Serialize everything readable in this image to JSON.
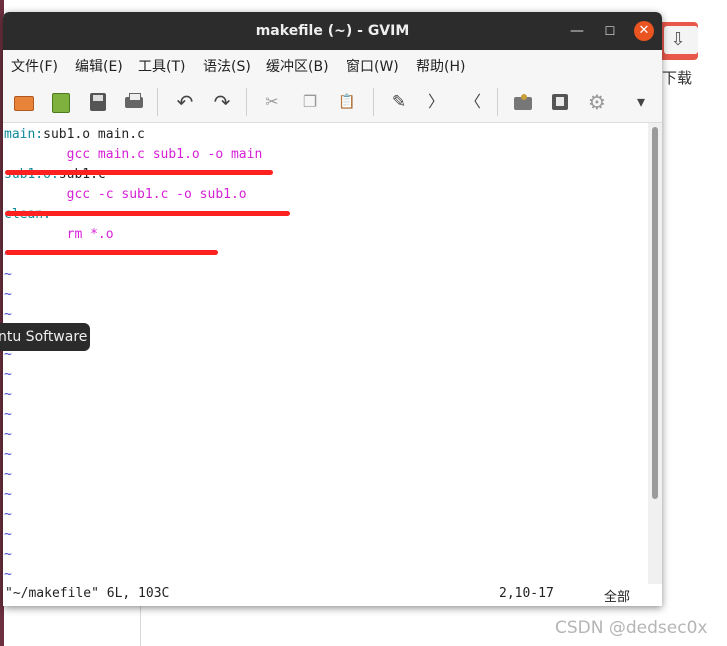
{
  "window": {
    "title": "makefile (~) - GVIM",
    "minimize_icon": "minimize-icon",
    "maximize_icon": "maximize-icon",
    "close_icon": "close-icon",
    "minimize_glyph": "—",
    "maximize_glyph": "☐",
    "close_glyph": "✕"
  },
  "menubar": {
    "items": [
      "文件(F)",
      "编辑(E)",
      "工具(T)",
      "语法(S)",
      "缓冲区(B)",
      "窗口(W)",
      "帮助(H)"
    ]
  },
  "toolbar": {
    "icons": [
      "open-file-icon",
      "save-icon",
      "save-all-icon",
      "print-icon",
      "undo-icon",
      "redo-icon",
      "cut-icon",
      "copy-icon",
      "paste-icon",
      "replace-icon",
      "find-next-icon",
      "find-prev-icon",
      "load-session-icon",
      "save-session-icon",
      "run-script-icon",
      "overflow-menu-icon"
    ],
    "undo_glyph": "↶",
    "redo_glyph": "↷",
    "cut_glyph": "✂",
    "copy_glyph": "❐",
    "paste_glyph": "📋",
    "find_next_glyph": "〉",
    "find_prev_glyph": "〈",
    "replace_glyph": "✎",
    "settings_glyph": "⚙",
    "overflow_glyph": "▾"
  },
  "editor": {
    "lines": [
      {
        "parts": [
          {
            "text": "main:",
            "color": "cyan"
          },
          {
            "text": "sub1.o main.c",
            "color": "black"
          }
        ]
      },
      {
        "parts": [
          {
            "text": "        gcc main.c sub1.o -o main",
            "color": "magenta"
          }
        ]
      },
      {
        "parts": [
          {
            "text": "sub1.o:",
            "color": "cyan"
          },
          {
            "text": "sub1.c",
            "color": "black"
          }
        ]
      },
      {
        "parts": [
          {
            "text": "        gcc -c sub1.c -o sub1.o",
            "color": "magenta"
          }
        ]
      },
      {
        "parts": [
          {
            "text": "clean:",
            "color": "cyan"
          }
        ]
      },
      {
        "parts": [
          {
            "text": "        rm *.o",
            "color": "magenta"
          }
        ]
      }
    ],
    "empty_line_marker": "~",
    "empty_line_count": 17
  },
  "statusline": {
    "file": "\"~/makefile\" 6L, 103C",
    "position": "2,10-17",
    "scroll": "全部"
  },
  "tooltip": {
    "text": "ntu Software"
  },
  "desktop": {
    "icon_label": "下载",
    "icon_glyph": "⇩",
    "watermark": "CSDN @dedsec0x"
  },
  "colors": {
    "cyan": "#0e8a9a",
    "magenta": "#d61fd6",
    "tilde": "#3b4fd4",
    "titlebar": "#2c2c2c",
    "close_button": "#e95420",
    "annotation": "#ff2020"
  }
}
